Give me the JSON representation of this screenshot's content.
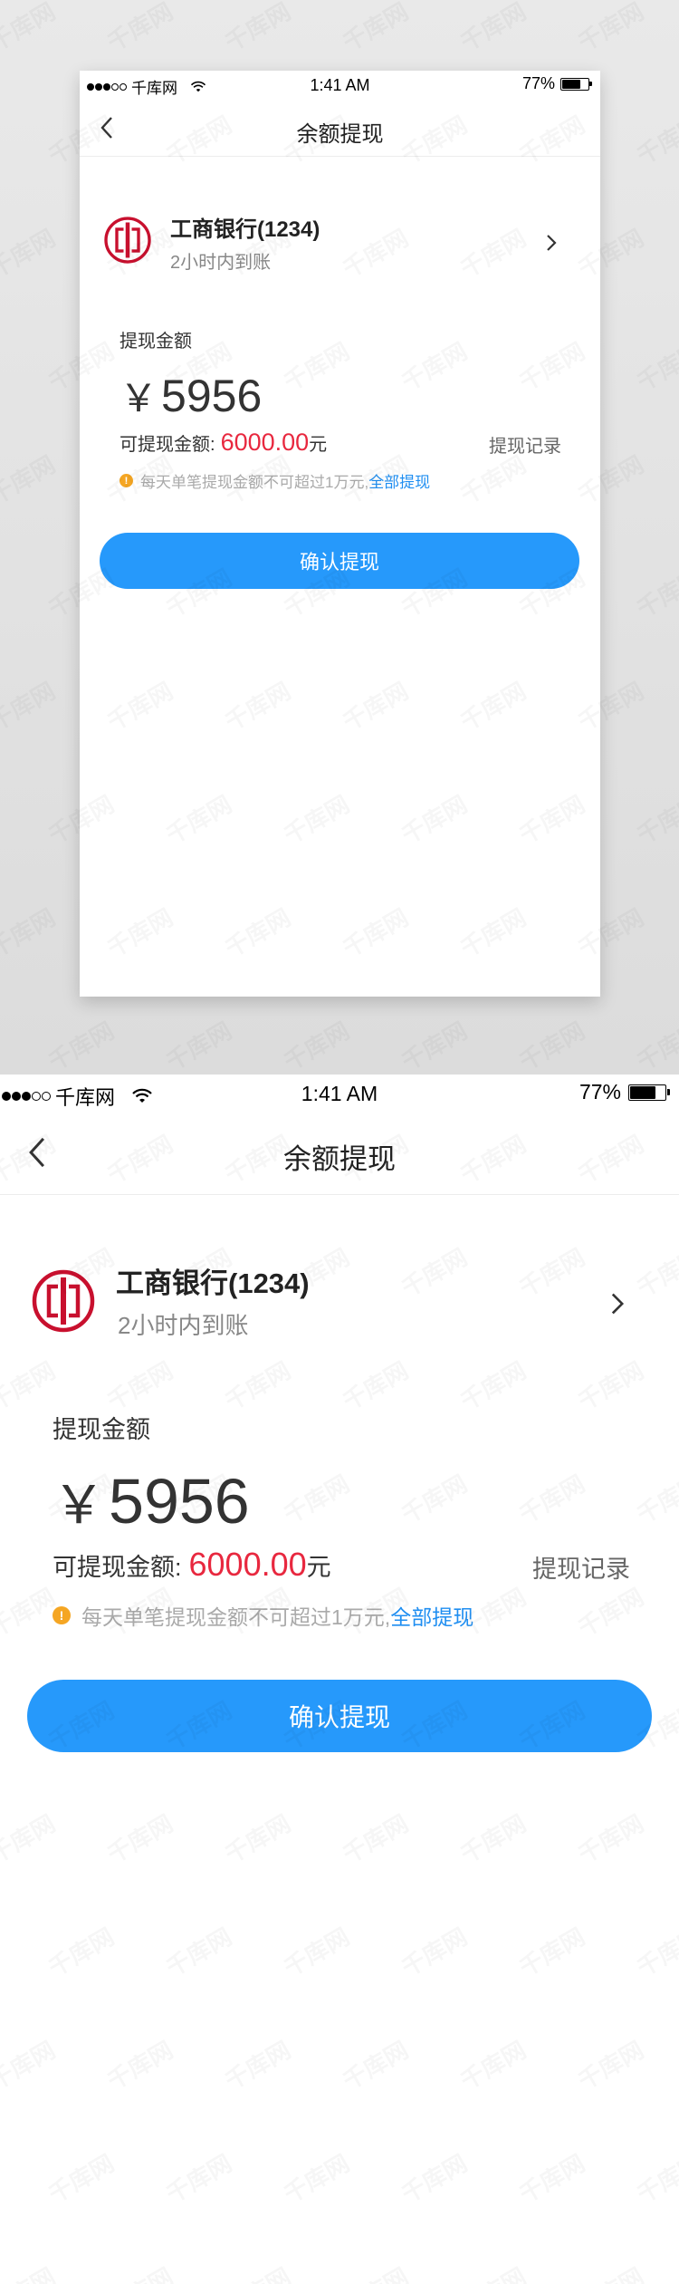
{
  "status": {
    "carrier": "千库网",
    "time": "1:41 AM",
    "battery_text": "77%",
    "battery_level": 0.77
  },
  "nav": {
    "title": "余额提现"
  },
  "bank": {
    "name": "工商银行(1234)",
    "arrival": "2小时内到账",
    "logo_icon": "icbc-logo-icon"
  },
  "withdraw": {
    "label": "提现金额",
    "currency": "￥",
    "amount": "5956",
    "available_label": "可提现金额:",
    "available_value": "6000.00",
    "available_unit": "元",
    "record_link": "提现记录",
    "hint_text": "每天单笔提现金额不可超过1万元,",
    "hint_all": "全部提现",
    "confirm_button": "确认提现"
  },
  "watermark": "千库网",
  "colors": {
    "accent": "#2699fb",
    "amount_red": "#e8283f",
    "link_blue": "#1f8ef1",
    "warn": "#f5a623",
    "bank_red": "#c8102e"
  }
}
